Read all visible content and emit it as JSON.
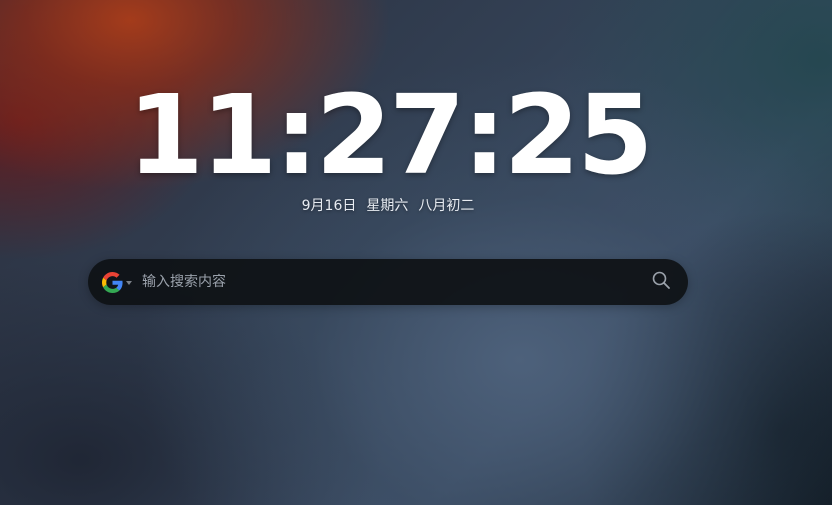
{
  "clock": {
    "time": "11:27:25"
  },
  "date": {
    "gregorian": "9月16日",
    "weekday": "星期六",
    "lunar": "八月初二"
  },
  "search": {
    "engine": "google-icon",
    "placeholder": "输入搜索内容",
    "value": ""
  },
  "colors": {
    "search_bar_bg": "#0e1115",
    "text": "#ffffff",
    "google_blue": "#4285F4",
    "google_red": "#EA4335",
    "google_yellow": "#FBBC05",
    "google_green": "#34A853"
  }
}
